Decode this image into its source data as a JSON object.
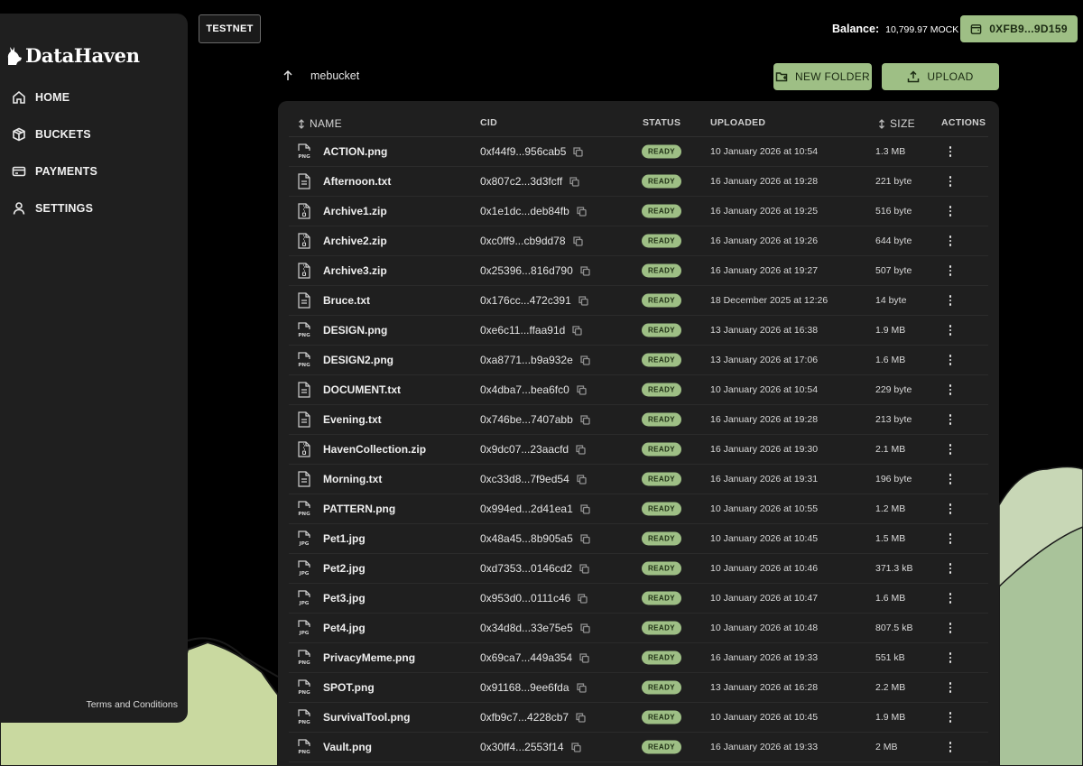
{
  "app": {
    "brand": "DataHaven",
    "network_badge": "TESTNET"
  },
  "sidebar": {
    "items": [
      {
        "label": "HOME",
        "icon": "home-icon"
      },
      {
        "label": "BUCKETS",
        "icon": "package-icon"
      },
      {
        "label": "PAYMENTS",
        "icon": "credit-card-icon"
      },
      {
        "label": "SETTINGS",
        "icon": "user-icon"
      }
    ],
    "footer_link": "Terms and Conditions"
  },
  "header": {
    "balance_label": "Balance:",
    "balance_value": "10,799.97 MOCK",
    "wallet_address": "0XFB9...9D159"
  },
  "breadcrumb": {
    "bucket": "mebucket"
  },
  "actions": {
    "new_folder": "NEW FOLDER",
    "upload": "UPLOAD"
  },
  "table": {
    "columns": {
      "name": "NAME",
      "cid": "CID",
      "status": "STATUS",
      "uploaded": "UPLOADED",
      "size": "SIZE",
      "actions": "ACTIONS"
    },
    "rows": [
      {
        "name": "ACTION.png",
        "type": "png",
        "cid": "0xf44f9...956cab5",
        "status": "READY",
        "uploaded": "10 January 2026 at 10:54",
        "size": "1.3 MB"
      },
      {
        "name": "Afternoon.txt",
        "type": "txt",
        "cid": "0x807c2...3d3fcff",
        "status": "READY",
        "uploaded": "16 January 2026 at 19:28",
        "size": "221 byte"
      },
      {
        "name": "Archive1.zip",
        "type": "zip",
        "cid": "0x1e1dc...deb84fb",
        "status": "READY",
        "uploaded": "16 January 2026 at 19:25",
        "size": "516 byte"
      },
      {
        "name": "Archive2.zip",
        "type": "zip",
        "cid": "0xc0ff9...cb9dd78",
        "status": "READY",
        "uploaded": "16 January 2026 at 19:26",
        "size": "644 byte"
      },
      {
        "name": "Archive3.zip",
        "type": "zip",
        "cid": "0x25396...816d790",
        "status": "READY",
        "uploaded": "16 January 2026 at 19:27",
        "size": "507 byte"
      },
      {
        "name": "Bruce.txt",
        "type": "txt",
        "cid": "0x176cc...472c391",
        "status": "READY",
        "uploaded": "18 December 2025 at 12:26",
        "size": "14 byte"
      },
      {
        "name": "DESIGN.png",
        "type": "png",
        "cid": "0xe6c11...ffaa91d",
        "status": "READY",
        "uploaded": "13 January 2026 at 16:38",
        "size": "1.9 MB"
      },
      {
        "name": "DESIGN2.png",
        "type": "png",
        "cid": "0xa8771...b9a932e",
        "status": "READY",
        "uploaded": "13 January 2026 at 17:06",
        "size": "1.6 MB"
      },
      {
        "name": "DOCUMENT.txt",
        "type": "txt",
        "cid": "0x4dba7...bea6fc0",
        "status": "READY",
        "uploaded": "10 January 2026 at 10:54",
        "size": "229 byte"
      },
      {
        "name": "Evening.txt",
        "type": "txt",
        "cid": "0x746be...7407abb",
        "status": "READY",
        "uploaded": "16 January 2026 at 19:28",
        "size": "213 byte"
      },
      {
        "name": "HavenCollection.zip",
        "type": "zip",
        "cid": "0x9dc07...23aacfd",
        "status": "READY",
        "uploaded": "16 January 2026 at 19:30",
        "size": "2.1 MB"
      },
      {
        "name": "Morning.txt",
        "type": "txt",
        "cid": "0xc33d8...7f9ed54",
        "status": "READY",
        "uploaded": "16 January 2026 at 19:31",
        "size": "196 byte"
      },
      {
        "name": "PATTERN.png",
        "type": "png",
        "cid": "0x994ed...2d41ea1",
        "status": "READY",
        "uploaded": "10 January 2026 at 10:55",
        "size": "1.2 MB"
      },
      {
        "name": "Pet1.jpg",
        "type": "jpg",
        "cid": "0x48a45...8b905a5",
        "status": "READY",
        "uploaded": "10 January 2026 at 10:45",
        "size": "1.5 MB"
      },
      {
        "name": "Pet2.jpg",
        "type": "jpg",
        "cid": "0xd7353...0146cd2",
        "status": "READY",
        "uploaded": "10 January 2026 at 10:46",
        "size": "371.3 kB"
      },
      {
        "name": "Pet3.jpg",
        "type": "jpg",
        "cid": "0x953d0...0111c46",
        "status": "READY",
        "uploaded": "10 January 2026 at 10:47",
        "size": "1.6 MB"
      },
      {
        "name": "Pet4.jpg",
        "type": "jpg",
        "cid": "0x34d8d...33e75e5",
        "status": "READY",
        "uploaded": "10 January 2026 at 10:48",
        "size": "807.5 kB"
      },
      {
        "name": "PrivacyMeme.png",
        "type": "png",
        "cid": "0x69ca7...449a354",
        "status": "READY",
        "uploaded": "16 January 2026 at 19:33",
        "size": "551 kB"
      },
      {
        "name": "SPOT.png",
        "type": "png",
        "cid": "0x91168...9ee6fda",
        "status": "READY",
        "uploaded": "13 January 2026 at 16:28",
        "size": "2.2 MB"
      },
      {
        "name": "SurvivalTool.png",
        "type": "png",
        "cid": "0xfb9c7...4228cb7",
        "status": "READY",
        "uploaded": "10 January 2026 at 10:45",
        "size": "1.9 MB"
      },
      {
        "name": "Vault.png",
        "type": "png",
        "cid": "0x30ff4...2553f14",
        "status": "READY",
        "uploaded": "16 January 2026 at 19:33",
        "size": "2 MB"
      }
    ]
  },
  "colors": {
    "accent": "#9ebf85",
    "panel": "#1f1f1f",
    "background": "#000000"
  }
}
